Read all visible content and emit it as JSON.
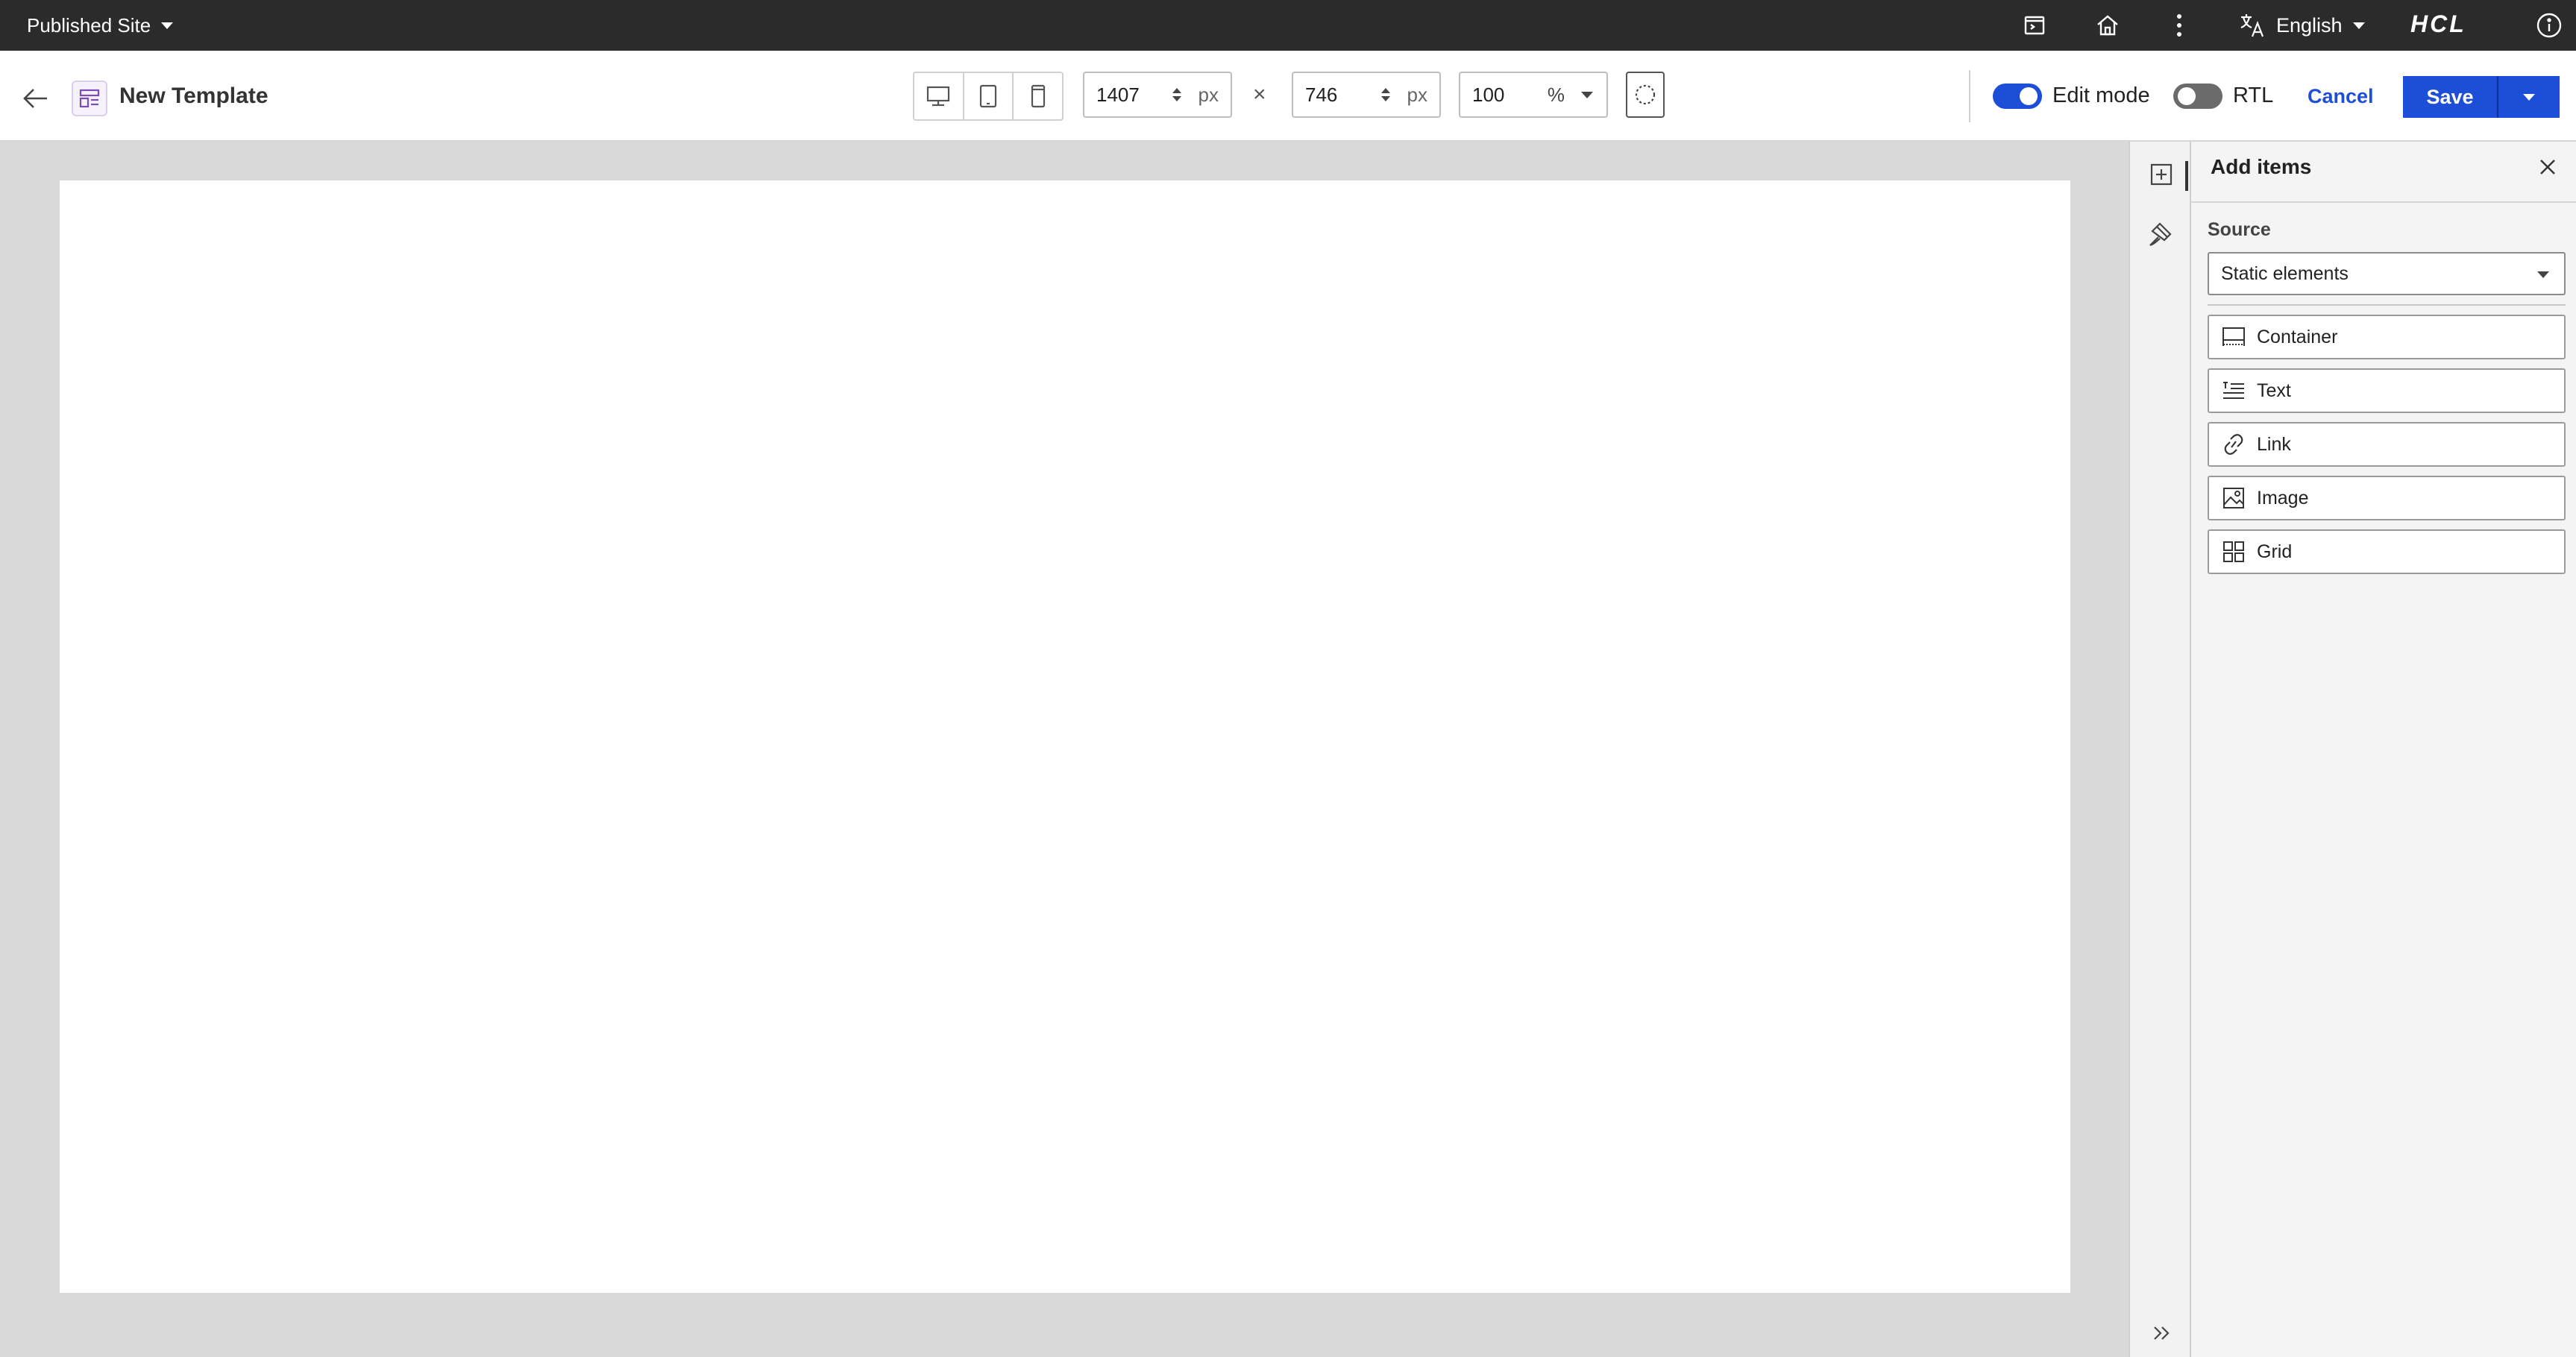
{
  "topbar": {
    "site_name": "Published Site",
    "language": "English",
    "brand": "HCL",
    "icons": [
      "preview-icon",
      "home-icon",
      "more-vertical-icon",
      "translate-icon",
      "info-icon"
    ]
  },
  "toolbar": {
    "page_title": "New Template",
    "width_value": "1407",
    "width_unit": "px",
    "height_value": "746",
    "height_unit": "px",
    "times_symbol": "×",
    "zoom_value": "100",
    "zoom_unit": "%",
    "edit_mode_label": "Edit mode",
    "edit_mode_on": true,
    "rtl_label": "RTL",
    "rtl_on": false,
    "cancel_label": "Cancel",
    "save_label": "Save"
  },
  "panel": {
    "title": "Add items",
    "source_label": "Source",
    "source_value": "Static elements",
    "items": [
      {
        "label": "Container",
        "icon": "container-icon"
      },
      {
        "label": "Text",
        "icon": "text-icon"
      },
      {
        "label": "Link",
        "icon": "link-icon"
      },
      {
        "label": "Image",
        "icon": "image-icon"
      },
      {
        "label": "Grid",
        "icon": "grid-icon"
      }
    ]
  },
  "colors": {
    "accent": "#1d4ed8",
    "topbar": "#2b2b2b",
    "workspace": "#d9d9d9",
    "panel": "#f4f4f4"
  }
}
